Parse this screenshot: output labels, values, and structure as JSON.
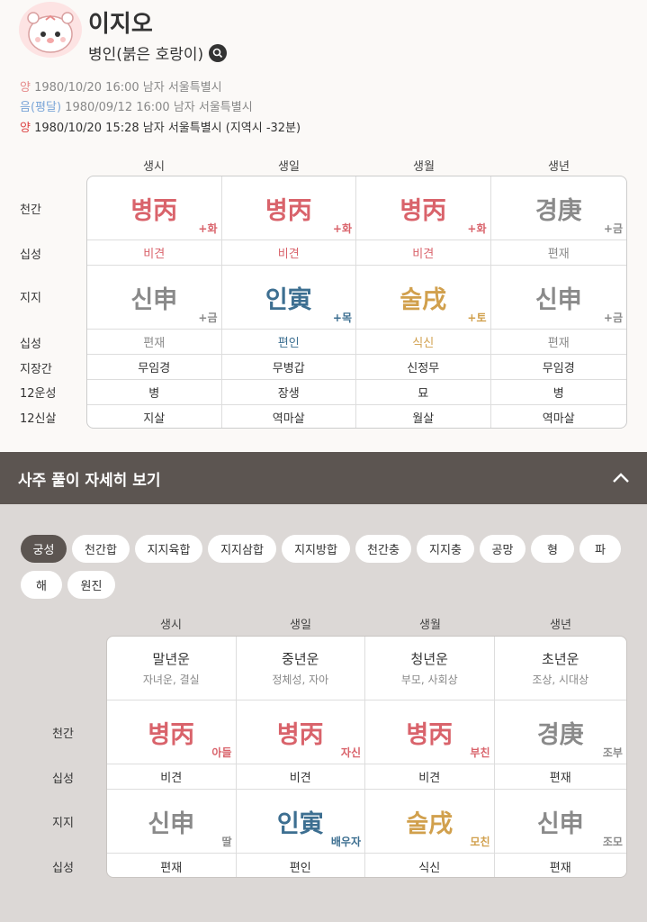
{
  "profile": {
    "name": "이지오",
    "subtitle": "병인(붉은 호랑이)",
    "lines": [
      {
        "tag": "양",
        "text": "1980/10/20 16:00 남자 서울특별시"
      },
      {
        "tag": "음(평달)",
        "text": "1980/09/12 16:00 남자 서울특별시"
      },
      {
        "tag": "양",
        "text": "1980/10/20 15:28 남자 서울특별시 (지역시 -32분)"
      }
    ]
  },
  "colors": {
    "fire": "#d9636b",
    "metal": "#8a8a8a",
    "wood": "#3d6f91",
    "earth": "#d1a04d",
    "bar": "#5c5551"
  },
  "table1": {
    "columns": [
      "생시",
      "생일",
      "생월",
      "생년"
    ],
    "row_labels": [
      "천간",
      "십성",
      "지지",
      "십성",
      "지장간",
      "12운성",
      "12신살"
    ],
    "cheongan": [
      {
        "text": "병丙",
        "tag": "+화"
      },
      {
        "text": "병丙",
        "tag": "+화"
      },
      {
        "text": "병丙",
        "tag": "+화"
      },
      {
        "text": "경庚",
        "tag": "+금"
      }
    ],
    "sipseong1": [
      "비견",
      "비견",
      "비견",
      "편재"
    ],
    "jiji": [
      {
        "text": "신申",
        "tag": "+금"
      },
      {
        "text": "인寅",
        "tag": "+목"
      },
      {
        "text": "술戌",
        "tag": "+토"
      },
      {
        "text": "신申",
        "tag": "+금"
      }
    ],
    "sipseong2": [
      "편재",
      "편인",
      "식신",
      "편재"
    ],
    "jijanggan": [
      "무임경",
      "무병갑",
      "신정무",
      "무임경"
    ],
    "unseong": [
      "병",
      "장생",
      "묘",
      "병"
    ],
    "sinsal": [
      "지살",
      "역마살",
      "월살",
      "역마살"
    ]
  },
  "bar": {
    "title": "사주 풀이 자세히 보기"
  },
  "chips": [
    "궁성",
    "천간합",
    "지지육합",
    "지지삼합",
    "지지방합",
    "천간충",
    "지지충",
    "공망",
    "형",
    "파",
    "해",
    "원진"
  ],
  "table2": {
    "columns": [
      "생시",
      "생일",
      "생월",
      "생년"
    ],
    "row_labels": [
      "천간",
      "십성",
      "지지",
      "십성"
    ],
    "header": [
      {
        "t1": "말년운",
        "t2": "자녀운, 결실"
      },
      {
        "t1": "중년운",
        "t2": "정체성, 자아"
      },
      {
        "t1": "청년운",
        "t2": "부모, 사회상"
      },
      {
        "t1": "초년운",
        "t2": "조상, 시대상"
      }
    ],
    "cheongan": [
      {
        "text": "병丙",
        "tag": "아들"
      },
      {
        "text": "병丙",
        "tag": "자신"
      },
      {
        "text": "병丙",
        "tag": "부친"
      },
      {
        "text": "경庚",
        "tag": "조부"
      }
    ],
    "sipseong1": [
      "비견",
      "비견",
      "비견",
      "편재"
    ],
    "jiji": [
      {
        "text": "신申",
        "tag": "딸"
      },
      {
        "text": "인寅",
        "tag": "배우자"
      },
      {
        "text": "술戌",
        "tag": "모친"
      },
      {
        "text": "신申",
        "tag": "조모"
      }
    ],
    "sipseong2": [
      "편재",
      "편인",
      "식신",
      "편재"
    ]
  }
}
